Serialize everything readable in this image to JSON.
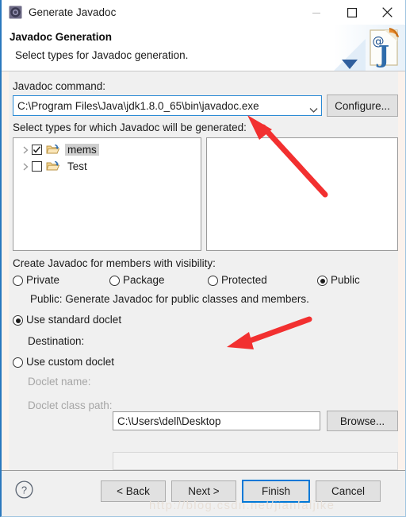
{
  "window": {
    "title": "Generate Javadoc",
    "icon": "javadoc-app-icon",
    "controls": {
      "minimize": "minimize-icon",
      "maximize": "maximize-icon",
      "close": "close-icon"
    }
  },
  "header": {
    "title": "Javadoc Generation",
    "subtitle": "Select types for Javadoc generation.",
    "banner_icon": "javadoc-at-j-icon"
  },
  "command": {
    "label": "Javadoc command:",
    "value": "C:\\Program Files\\Java\\jdk1.8.0_65\\bin\\javadoc.exe",
    "dropdown_icon": "chevron-down-icon",
    "configure_button": "Configure..."
  },
  "types": {
    "label": "Select types for which Javadoc will be generated:",
    "tree": [
      {
        "name": "mems",
        "checked": true,
        "selected": true,
        "expander": "chevron-right-icon",
        "icon": "folder-icon"
      },
      {
        "name": "Test",
        "checked": false,
        "selected": false,
        "expander": "chevron-right-icon",
        "icon": "folder-icon"
      }
    ],
    "members": []
  },
  "visibility": {
    "label": "Create Javadoc for members with visibility:",
    "options": [
      {
        "label": "Private",
        "selected": false
      },
      {
        "label": "Package",
        "selected": false
      },
      {
        "label": "Protected",
        "selected": false
      },
      {
        "label": "Public",
        "selected": true
      }
    ],
    "description": "Public: Generate Javadoc for public classes and members."
  },
  "doclet": {
    "standard": {
      "label": "Use standard doclet",
      "selected": true
    },
    "destination": {
      "label": "Destination:",
      "value": "C:\\Users\\dell\\Desktop",
      "browse_button": "Browse..."
    },
    "custom": {
      "label": "Use custom doclet",
      "selected": false
    },
    "doclet_name": {
      "label": "Doclet name:",
      "value": "",
      "disabled": true
    },
    "doclet_class_path": {
      "label": "Doclet class path:",
      "value": "",
      "disabled": true
    }
  },
  "footer": {
    "help_icon": "help-question-icon",
    "buttons": [
      {
        "label": "< Back",
        "default": false
      },
      {
        "label": "Next >",
        "default": false
      },
      {
        "label": "Finish",
        "default": true
      },
      {
        "label": "Cancel",
        "default": false
      }
    ]
  },
  "watermark": "http://blog.csdn.net/jianfaljike",
  "annotations": [
    {
      "name": "arrow-to-javadoc-command",
      "color": "#f23030"
    },
    {
      "name": "arrow-to-destination",
      "color": "#f23030"
    }
  ],
  "colors": {
    "accent": "#0078d7",
    "window_border": "#2a78bd",
    "dialog_bg": "#f0f0f0",
    "annotation_red": "#f23030"
  }
}
